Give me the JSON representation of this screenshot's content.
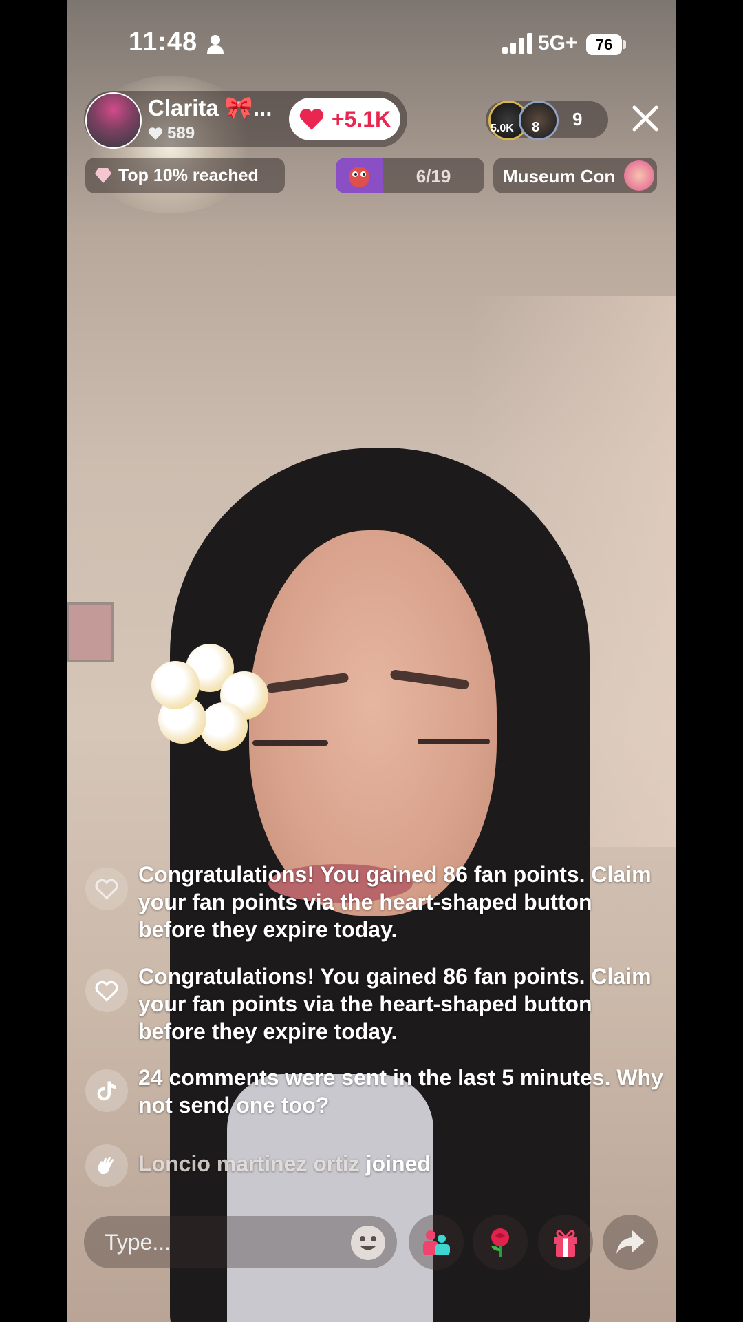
{
  "status_bar": {
    "time": "11:48",
    "network": "5G+",
    "battery": "76"
  },
  "host": {
    "name": "Clarita 🎀...",
    "likes": "589",
    "like_button_label": "+5.1K"
  },
  "viewers": {
    "badge_1": "5.0K",
    "badge_2": "8",
    "count": "9"
  },
  "badges": {
    "top_label": "Top 10% reached",
    "goal_progress": "6/19",
    "museum_label": "Museum Con"
  },
  "chat": [
    {
      "icon": "heart-outline-icon",
      "text": "Congratulations! You gained 86 fan points. Claim your fan points via the heart-shaped button before they expire today."
    },
    {
      "icon": "heart-outline-icon",
      "text": "Congratulations! You gained 86 fan points. Claim your fan points via the heart-shaped button before they expire today."
    },
    {
      "icon": "tiktok-icon",
      "text": "24 comments were sent in the last 5 minutes. Why not send one too?"
    },
    {
      "icon": "waving-hand-icon",
      "name": "Loncio martinez ortiz",
      "action": "joined"
    }
  ],
  "input": {
    "placeholder": "Type..."
  },
  "colors": {
    "accent": "#e8264f",
    "goal": "#8b4fc5",
    "gift": "#f0436e"
  }
}
